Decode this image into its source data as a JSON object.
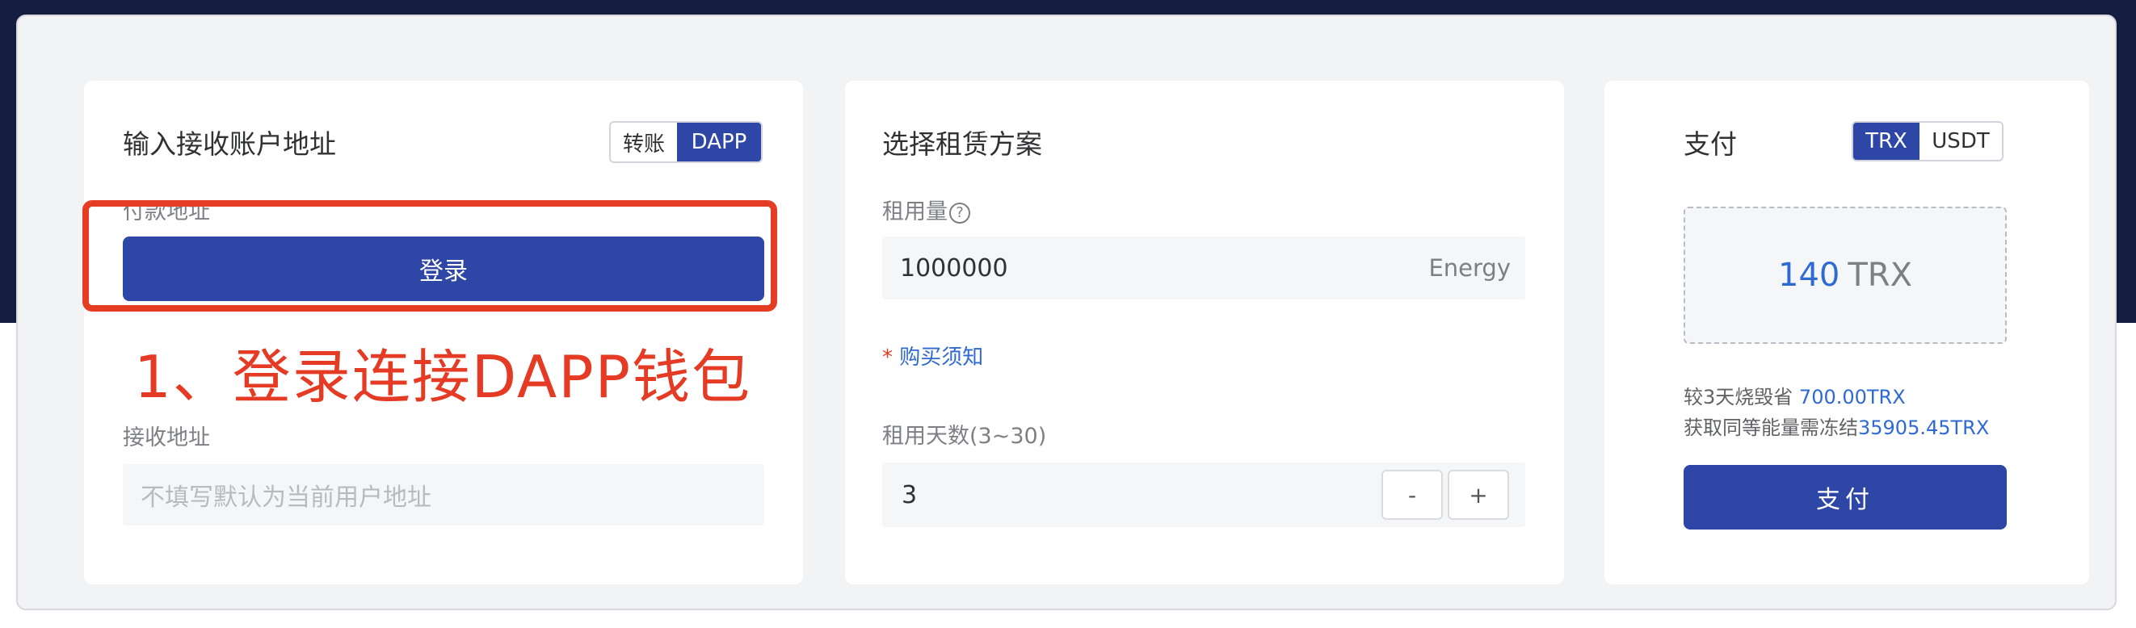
{
  "left": {
    "title": "输入接收账户地址",
    "mode_options": [
      "转账",
      "DAPP"
    ],
    "mode_selected": "DAPP",
    "payer_label": "付款地址",
    "login_button": "登录",
    "annotation": "1、登录连接DAPP钱包",
    "receiver_label": "接收地址",
    "receiver_placeholder": "不填写默认为当前用户地址"
  },
  "middle": {
    "title": "选择租赁方案",
    "amount_label": "租用量",
    "help_icon": "?",
    "amount_value": "1000000",
    "amount_unit": "Energy",
    "notice_star": "*",
    "notice_text": "购买须知",
    "days_label": "租用天数(3~30)",
    "days_value": "3",
    "minus_label": "-",
    "plus_label": "+"
  },
  "right": {
    "title": "支付",
    "currency_options": [
      "TRX",
      "USDT"
    ],
    "currency_selected": "TRX",
    "price_amount": "140",
    "price_currency": "TRX",
    "saving_prefix": "较3天烧毁省",
    "saving_value": "700.00TRX",
    "freeze_prefix": "获取同等能量需冻结",
    "freeze_value": "35905.45TRX",
    "pay_button": "支付"
  },
  "colors": {
    "primary": "#2e47a6",
    "annotation_red": "#e53b25",
    "link_blue": "#2e6ad1",
    "header_navy": "#141c40"
  }
}
